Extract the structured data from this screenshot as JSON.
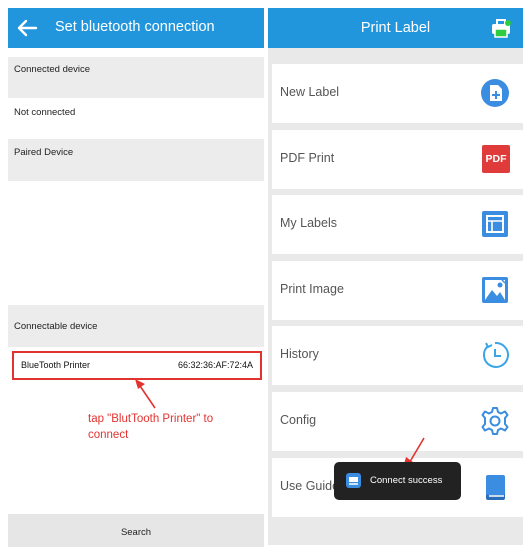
{
  "left": {
    "title": "Set bluetooth connection",
    "connected_header": "Connected device",
    "connected_status": "Not connected",
    "paired_header": "Paired Device",
    "connectable_header": "Connectable device",
    "device": {
      "name": "BlueTooth Printer",
      "mac": "66:32:36:AF:72:4A"
    },
    "annotation_line1": "tap \"BlutTooth Printer\" to",
    "annotation_line2": "connect",
    "search_label": "Search"
  },
  "right": {
    "title": "Print Label",
    "menu": [
      {
        "label": "New Label",
        "icon": "new-label-icon"
      },
      {
        "label": "PDF Print",
        "icon": "pdf-icon",
        "badge": "PDF"
      },
      {
        "label": "My Labels",
        "icon": "my-labels-icon"
      },
      {
        "label": "Print Image",
        "icon": "image-icon"
      },
      {
        "label": "History",
        "icon": "history-icon"
      },
      {
        "label": "Config",
        "icon": "gear-icon"
      },
      {
        "label": "Use Guide",
        "icon": "book-icon"
      }
    ],
    "toast": "Connect success"
  },
  "colors": {
    "accent": "#2196dc",
    "annotation": "#e3332f",
    "pdf_badge": "#e03b3b",
    "toast_bg": "#222222"
  }
}
